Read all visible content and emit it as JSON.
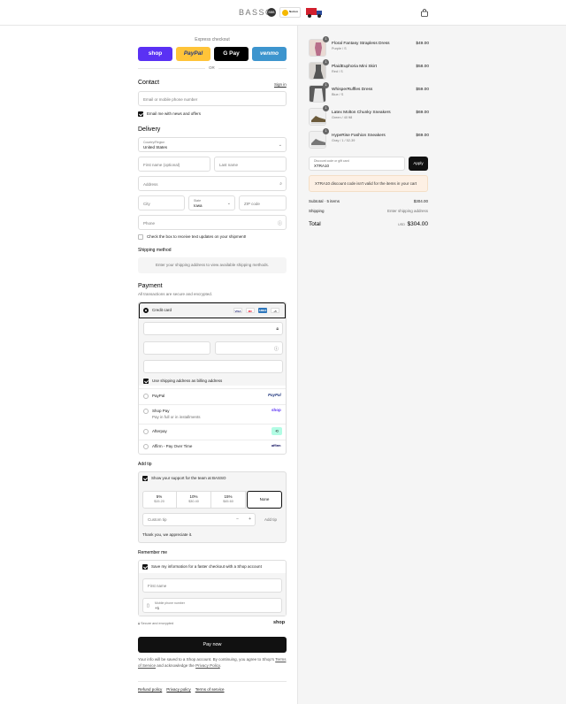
{
  "header": {
    "brand": "BASSO",
    "badge_bbb": "BBB",
    "badge_norton": "Norton",
    "cart_icon": "shopping-bag-icon"
  },
  "express": {
    "label": "Express checkout",
    "buttons": [
      {
        "label": "shop",
        "color": "#5a31f4"
      },
      {
        "label": "PayPal",
        "color": "#ffc439"
      },
      {
        "label": "G Pay",
        "color": "#000000"
      },
      {
        "label": "venmo",
        "color": "#3d95ce"
      }
    ],
    "or": "OR"
  },
  "contact": {
    "heading": "Contact",
    "signin": "Sign in",
    "email_placeholder": "Email or mobile phone number",
    "news_label": "Email me with news and offers"
  },
  "delivery": {
    "heading": "Delivery",
    "country_label": "Country/Region",
    "country_value": "United States",
    "first_name": "First name (optional)",
    "last_name": "Last name",
    "address": "Address",
    "city": "City",
    "state_label": "State",
    "state_value": "Iowa",
    "zip": "ZIP code",
    "phone": "Phone",
    "sms_label": "Check the box to receive text updates on your shipment!"
  },
  "shipping": {
    "heading": "Shipping method",
    "info": "Enter your shipping address to view available shipping methods."
  },
  "payment": {
    "heading": "Payment",
    "sub": "All transactions are secure and encrypted.",
    "credit_card": "Credit card",
    "card_logos": [
      "VISA",
      "MC",
      "AMEX",
      "+5"
    ],
    "billing_label": "Use shipping address as billing address",
    "methods": [
      {
        "label": "PayPal",
        "logo": "PayPal"
      },
      {
        "label": "Shop Pay",
        "sub": "Pay in full or in installments",
        "logo": "shop"
      },
      {
        "label": "Afterpay",
        "logo": "⟲"
      },
      {
        "label": "Affirm - Pay Over Time",
        "logo": "affirm"
      }
    ]
  },
  "tip": {
    "heading": "Add tip",
    "support_label": "Show your support for the team at BASSO",
    "options": [
      {
        "pct": "5%",
        "amt": "$15.20"
      },
      {
        "pct": "10%",
        "amt": "$30.40"
      },
      {
        "pct": "15%",
        "amt": "$45.60"
      },
      {
        "pct": "None",
        "amt": ""
      }
    ],
    "custom_placeholder": "Custom tip",
    "add_label": "Add tip",
    "thanks": "Thank you, we appreciate it."
  },
  "remember": {
    "heading": "Remember me",
    "save_label": "Save my information for a faster checkout with a Shop account",
    "first_name": "First name",
    "phone_label": "Mobile phone number",
    "phone_value": "+1",
    "secure": "Secure and encrypted",
    "shop": "shop"
  },
  "pay_now": "Pay now",
  "legal": {
    "text1": "Your info will be saved to a Shop account. By continuing, you agree to Shop's",
    "terms": "Terms of Service",
    "text2": "and acknowledge the",
    "privacy": "Privacy Policy",
    "text3": "."
  },
  "footer": [
    "Refund policy",
    "Privacy policy",
    "Terms of service"
  ],
  "cart": {
    "items": [
      {
        "qty": "1",
        "name": "Floral Fantasy Strapless Dress",
        "variant": "Purple / S",
        "price": "$49.00"
      },
      {
        "qty": "1",
        "name": "PlaidEuphoria Mini Skirt",
        "variant": "Red / S",
        "price": "$58.00"
      },
      {
        "qty": "1",
        "name": "WhisperRuffles Dress",
        "variant": "Blue / S",
        "price": "$59.00"
      },
      {
        "qty": "1",
        "name": "Latex Molton Chunky Sneakers",
        "variant": "Green / 40 ¥8",
        "price": "$69.00"
      },
      {
        "qty": "1",
        "name": "HypeRise Fashion Sneakers",
        "variant": "Gray / 1 / 52-39",
        "price": "$69.00"
      }
    ],
    "discount_label": "Discount code or gift card",
    "discount_value": "XTRA10",
    "apply": "Apply",
    "warning": "XTRA10 discount code isn't valid for the items in your cart",
    "subtotal_label": "Subtotal · 5 items",
    "subtotal_value": "$304.00",
    "shipping_label": "Shipping",
    "shipping_value": "Enter shipping address",
    "total_label": "Total",
    "currency": "USD",
    "total_value": "$304.00"
  }
}
